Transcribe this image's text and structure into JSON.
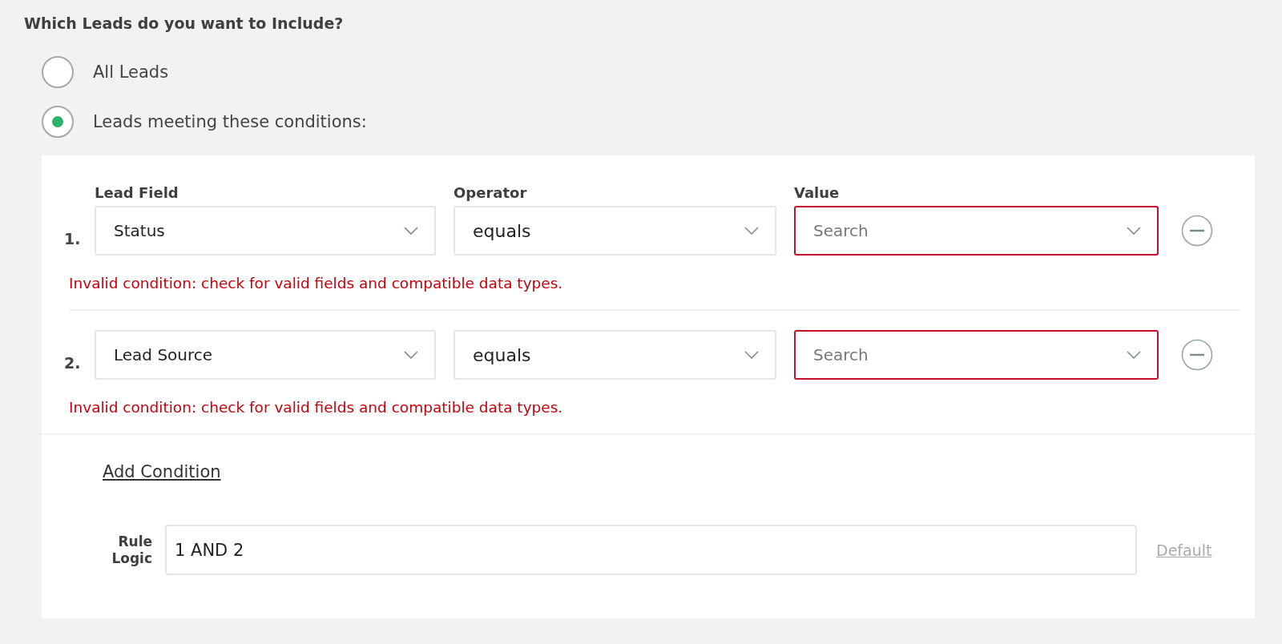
{
  "heading": "Which Leads do you want to Include?",
  "options": [
    {
      "label": "All Leads",
      "selected": false
    },
    {
      "label": "Leads meeting these conditions:",
      "selected": true
    }
  ],
  "columns": [
    "Lead Field",
    "Operator",
    "Value"
  ],
  "conditions": [
    {
      "number": "1.",
      "field": "Status",
      "operator": "equals",
      "value_placeholder": "Search",
      "invalid": true,
      "error": "Invalid condition: check for valid fields and compatible data types."
    },
    {
      "number": "2.",
      "field": "Lead Source",
      "operator": "equals",
      "value_placeholder": "Search",
      "invalid": true,
      "error": "Invalid condition: check for valid fields and compatible data types."
    }
  ],
  "add_condition": "Add Condition",
  "rule_logic": {
    "label": "Rule Logic",
    "value": "1 AND 2",
    "default_link": "Default"
  }
}
